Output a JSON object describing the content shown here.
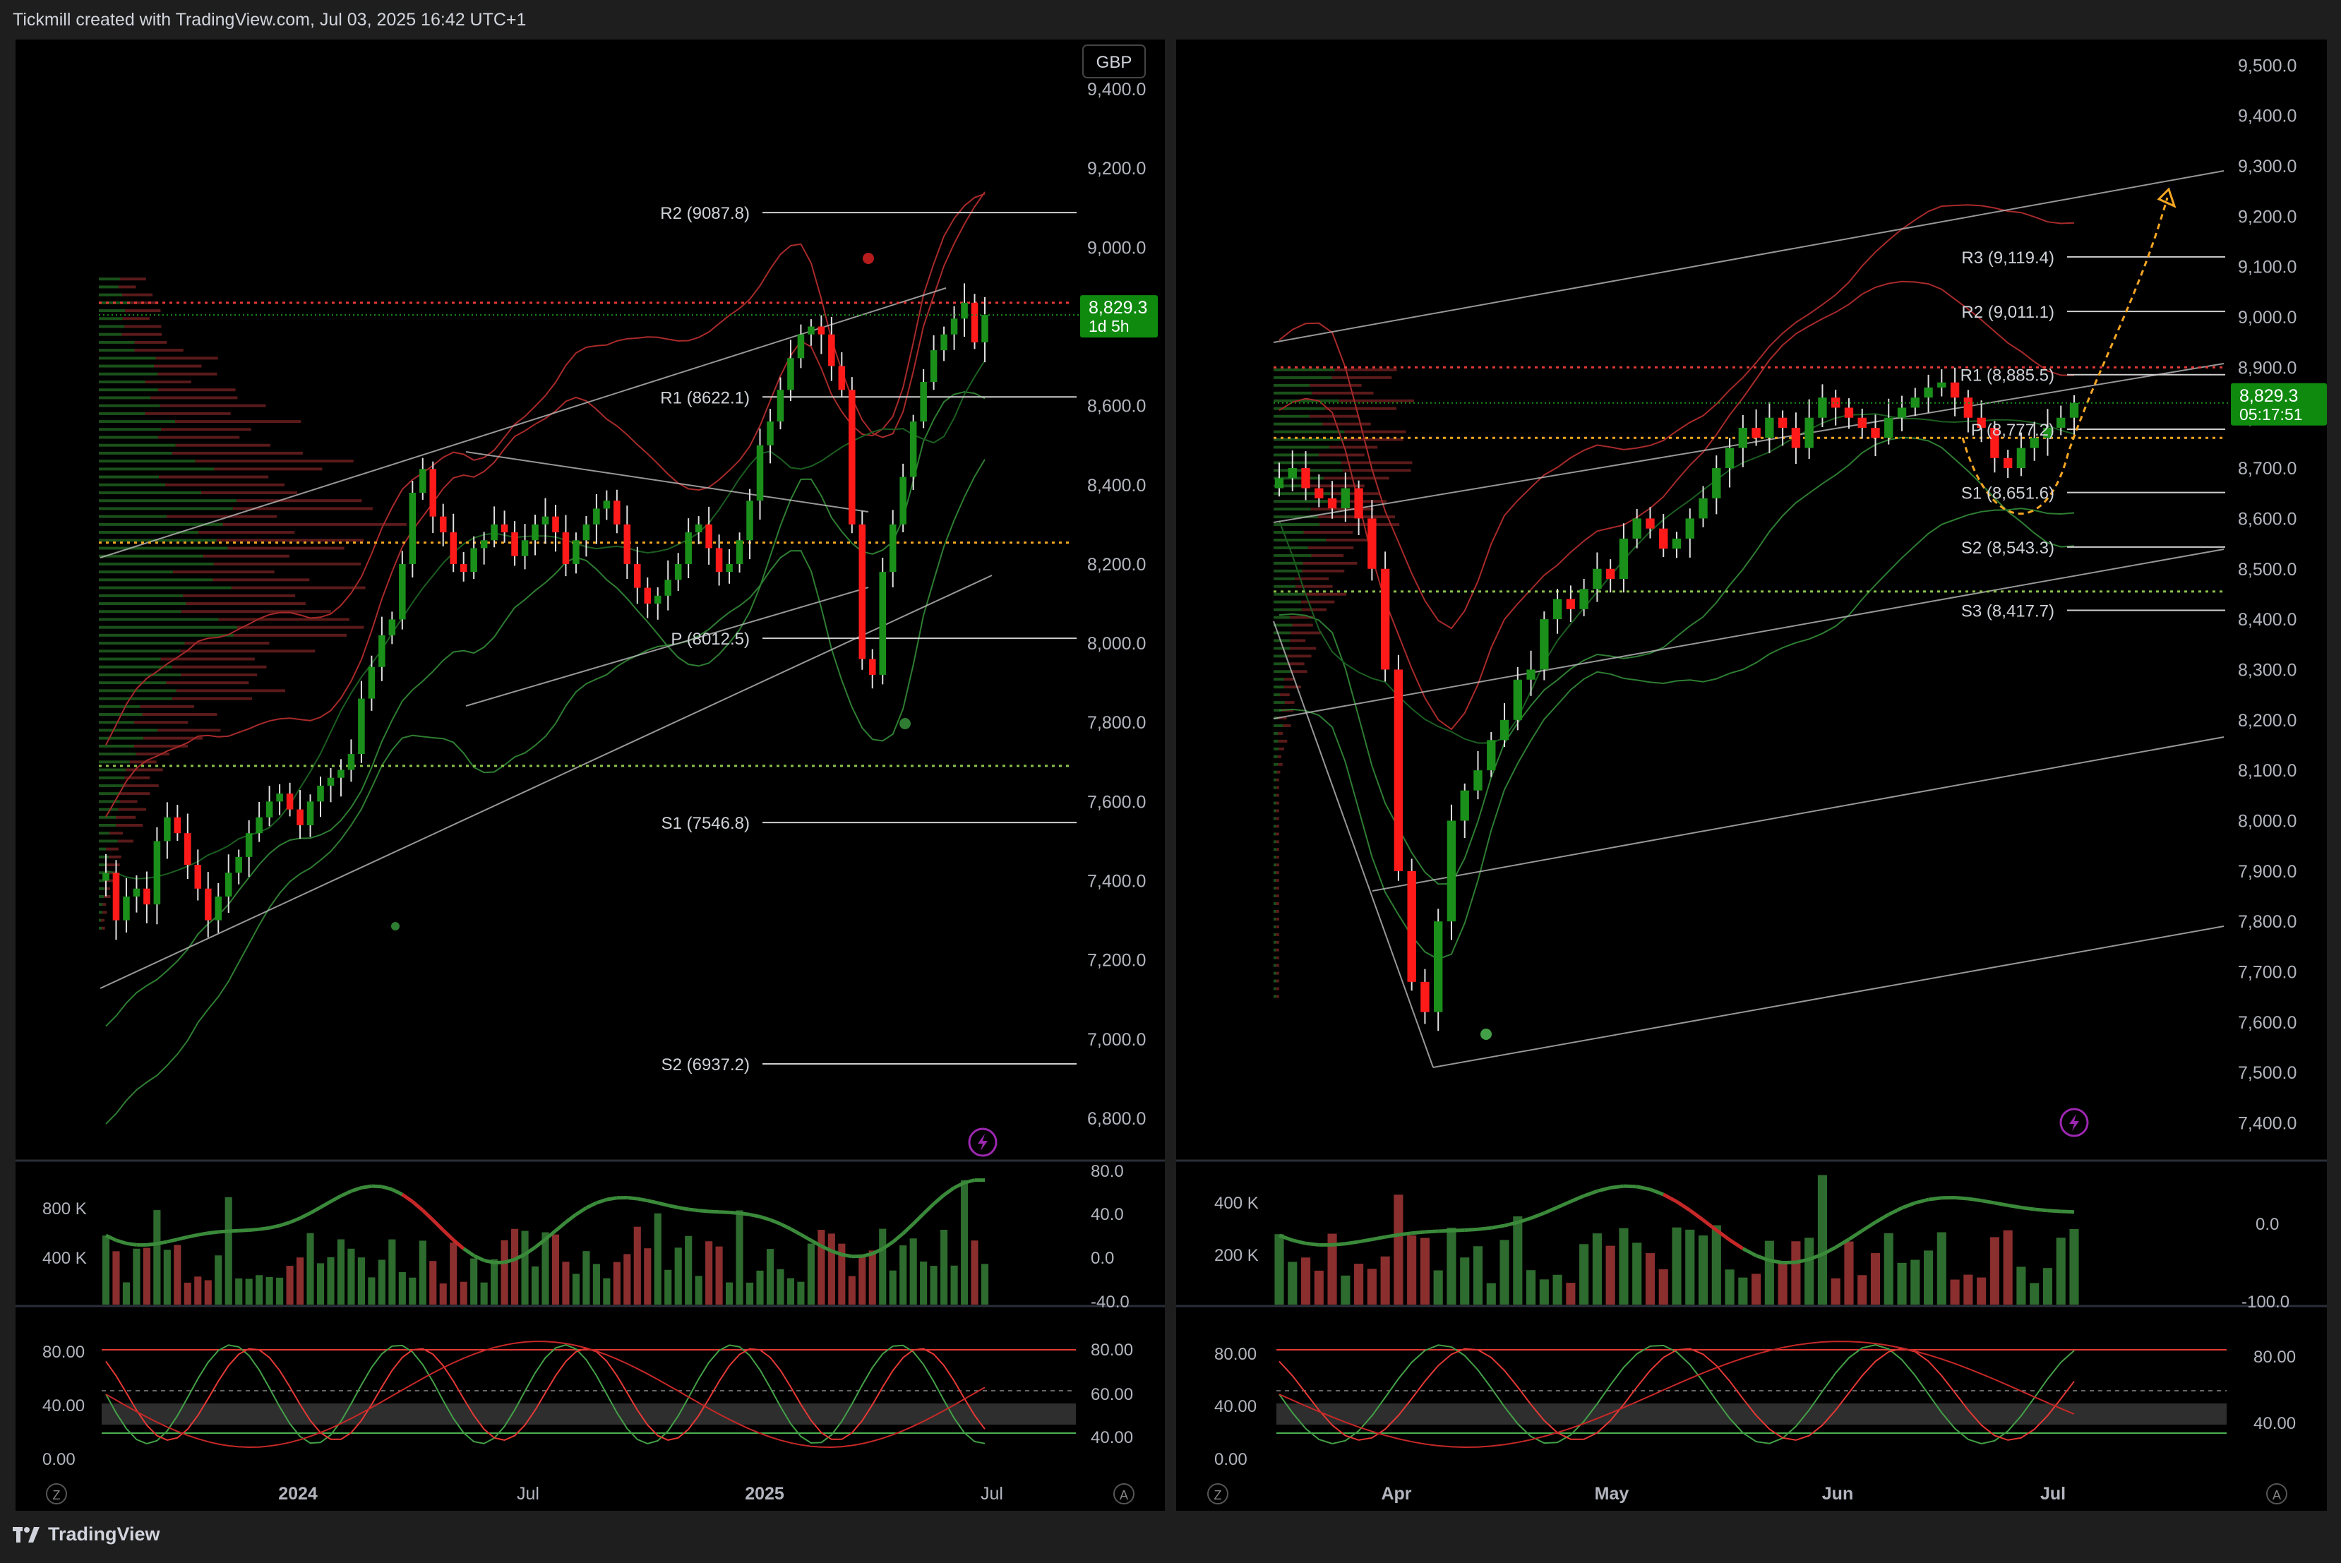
{
  "header": {
    "title": "Tickmill created with TradingView.com, Jul 03, 2025 16:42 UTC+1"
  },
  "footer": {
    "brand": "TradingView"
  },
  "colors": {
    "background": "#000000",
    "frame": "#1e1e1e",
    "up": "#1a8f1a",
    "down": "#ff1a1a",
    "price_label": "#0f8a0f",
    "pivot_line": "#cfcfcf",
    "channel": "#bdbdbd",
    "bb_red": "#a82a2a",
    "bb_green": "#2e7d32",
    "forecast": "#f5a623",
    "rsi_upper": "#e53935",
    "rsi_lower": "#4caf50"
  },
  "icons": {
    "lightning": "lightning-icon",
    "logo": "tradingview-logo-icon"
  },
  "chart_data": [
    {
      "panel": "left-main",
      "type": "candlestick",
      "currency": "GBP",
      "last_price": "8,829.3",
      "countdown": "1d 5h",
      "ylim": [
        6700,
        9500
      ],
      "y_ticks": [
        "9,400.0",
        "9,200.0",
        "9,000.0",
        "8,800.0",
        "8,600.0",
        "8,400.0",
        "8,200.0",
        "8,000.0",
        "7,800.0",
        "7,600.0",
        "7,400.0",
        "7,200.0",
        "7,000.0",
        "6,800.0"
      ],
      "x_ticks": [
        "2024",
        "Jul",
        "2025",
        "Jul"
      ],
      "pivots": [
        {
          "label": "R2 (9087.8)",
          "value": 9087.8
        },
        {
          "label": "R1 (8622.1)",
          "value": 8622.1
        },
        {
          "label": "P (8012.5)",
          "value": 8012.5
        },
        {
          "label": "S1 (7546.8)",
          "value": 7546.8
        },
        {
          "label": "S2 (6937.2)",
          "value": 6937.2
        }
      ],
      "ohlc_close": [
        7420,
        7300,
        7360,
        7380,
        7340,
        7500,
        7560,
        7520,
        7440,
        7380,
        7300,
        7360,
        7420,
        7460,
        7520,
        7560,
        7600,
        7620,
        7580,
        7540,
        7600,
        7640,
        7660,
        7680,
        7720,
        7860,
        7940,
        8020,
        8060,
        8200,
        8380,
        8440,
        8320,
        8280,
        8200,
        8180,
        8240,
        8260,
        8300,
        8280,
        8220,
        8260,
        8300,
        8320,
        8280,
        8200,
        8260,
        8300,
        8340,
        8360,
        8300,
        8200,
        8140,
        8100,
        8120,
        8160,
        8200,
        8280,
        8300,
        8240,
        8180,
        8200,
        8260,
        8360,
        8500,
        8560,
        8640,
        8720,
        8780,
        8800,
        8780,
        8700,
        8640,
        8300,
        7960,
        7920,
        8180,
        8300,
        8420,
        8560,
        8660,
        8740,
        8780,
        8820,
        8860,
        8760,
        8829.3
      ],
      "volume_ylim": [
        0,
        1000
      ],
      "volume_ticks": [
        "800 K",
        "400 K"
      ],
      "osc1_ticks": [
        "80.0",
        "40.0",
        "0.0",
        "-40.0"
      ],
      "rsi_ticks_left": [
        "80.00",
        "40.00",
        "0.00"
      ],
      "rsi_ticks_right": [
        "80.00",
        "60.00",
        "40.00"
      ]
    },
    {
      "panel": "right-main",
      "type": "candlestick",
      "last_price": "8,829.3",
      "countdown": "05:17:51",
      "ylim": [
        7370,
        9520
      ],
      "y_ticks": [
        "9,500.0",
        "9,400.0",
        "9,300.0",
        "9,200.0",
        "9,100.0",
        "9,000.0",
        "8,900.0",
        "8,800.0",
        "8,700.0",
        "8,600.0",
        "8,500.0",
        "8,400.0",
        "8,300.0",
        "8,200.0",
        "8,100.0",
        "8,000.0",
        "7,900.0",
        "7,800.0",
        "7,700.0",
        "7,600.0",
        "7,500.0",
        "7,400.0"
      ],
      "x_ticks": [
        "Apr",
        "May",
        "Jun",
        "Jul"
      ],
      "pivots": [
        {
          "label": "R3 (9,119.4)",
          "value": 9119.4
        },
        {
          "label": "R2 (9,011.1)",
          "value": 9011.1
        },
        {
          "label": "R1 (8,885.5)",
          "value": 8885.5
        },
        {
          "label": "P (8,777.2)",
          "value": 8777.2
        },
        {
          "label": "S1 (8,651.6)",
          "value": 8651.6
        },
        {
          "label": "S2 (8,543.3)",
          "value": 8543.3
        },
        {
          "label": "S3 (8,417.7)",
          "value": 8417.7
        }
      ],
      "ohlc_close": [
        8680,
        8700,
        8660,
        8640,
        8620,
        8660,
        8600,
        8500,
        8300,
        7900,
        7680,
        7620,
        7800,
        8000,
        8060,
        8100,
        8160,
        8200,
        8280,
        8300,
        8400,
        8440,
        8420,
        8460,
        8500,
        8480,
        8560,
        8600,
        8580,
        8540,
        8560,
        8600,
        8640,
        8700,
        8740,
        8780,
        8760,
        8800,
        8780,
        8740,
        8800,
        8840,
        8820,
        8800,
        8780,
        8760,
        8800,
        8820,
        8840,
        8860,
        8870,
        8840,
        8800,
        8780,
        8720,
        8700,
        8740,
        8760,
        8780,
        8800,
        8829.3
      ],
      "volume_ticks": [
        "400 K",
        "200 K"
      ],
      "osc1_ticks": [
        "0.0",
        "-100.0"
      ],
      "rsi_ticks_left": [
        "80.00",
        "40.00",
        "0.00"
      ],
      "rsi_ticks_right": [
        "80.00",
        "40.00"
      ]
    }
  ]
}
